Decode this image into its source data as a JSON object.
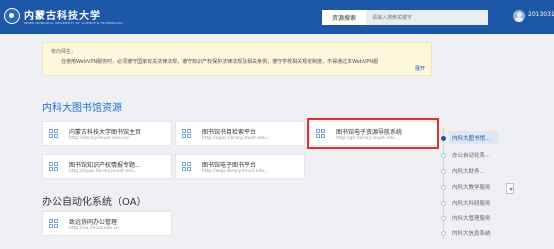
{
  "header": {
    "logo_title": "内蒙古科技大学",
    "logo_subtitle": "INNER MONGOLIA UNIVERSITY OF SCIENCE & TECHNOLOGY",
    "search_button": "资源搜索",
    "search_placeholder": "请输入搜索关键字",
    "user_name": "2013031"
  },
  "notice": {
    "greeting": "校内师生：",
    "text": "在使用WebVPN服务时，必须遵守国家有关法律法规，遵守知识产权保护法律法规及相关条例，遵守学校相关规定制度，不得通过本WebVPN服",
    "link": "展开"
  },
  "library_section": {
    "title": "内科大图书馆资源",
    "cards": [
      {
        "title": "内蒙古科技大学图书馆主页",
        "url": "http://library.imust.edu.cn/"
      },
      {
        "title": "图书馆书目检索平台",
        "url": "http://opac.library.imust.edu..."
      },
      {
        "title": "图书馆电子资源导航系统",
        "url": "http://gh.library.imust.edu...."
      },
      {
        "title": "图书馆知识产权情报专题...",
        "url": "http://sipac.library.imust.edu..."
      },
      {
        "title": "图书馆电子图书平台",
        "url": "http://wap.library.imust.edu..."
      }
    ]
  },
  "oa_section": {
    "title": "办公自动化系统（OA）",
    "cards": [
      {
        "title": "致远协同办公管理",
        "url": "http://oa.imust.edu.cn"
      }
    ]
  },
  "side_nav": {
    "items": [
      "内科大图书馆...",
      "办公自动化系...",
      "内科大财务...",
      "内科大教学服务",
      "内科大科研服务",
      "内科大管理服务",
      "内科大信息系统"
    ]
  },
  "colors": {
    "header_bg": "#1d57a8",
    "accent": "#1e6fd0",
    "highlight": "#e0312f"
  }
}
